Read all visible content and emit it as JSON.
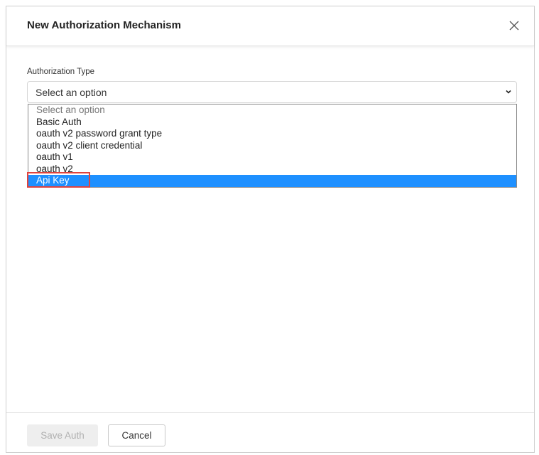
{
  "dialog": {
    "title": "New Authorization Mechanism",
    "close_icon": "close-icon"
  },
  "form": {
    "auth_type_label": "Authorization Type",
    "select_value": "Select an option",
    "options": [
      "Select an option",
      "Basic Auth",
      "oauth v2 password grant type",
      "oauth v2 client credential",
      "oauth v1",
      "oauth v2",
      "Api Key"
    ],
    "highlighted_option": "Api Key"
  },
  "footer": {
    "save_label": "Save Auth",
    "cancel_label": "Cancel"
  },
  "colors": {
    "highlight": "#1e90ff",
    "annotation": "#e0433d"
  }
}
